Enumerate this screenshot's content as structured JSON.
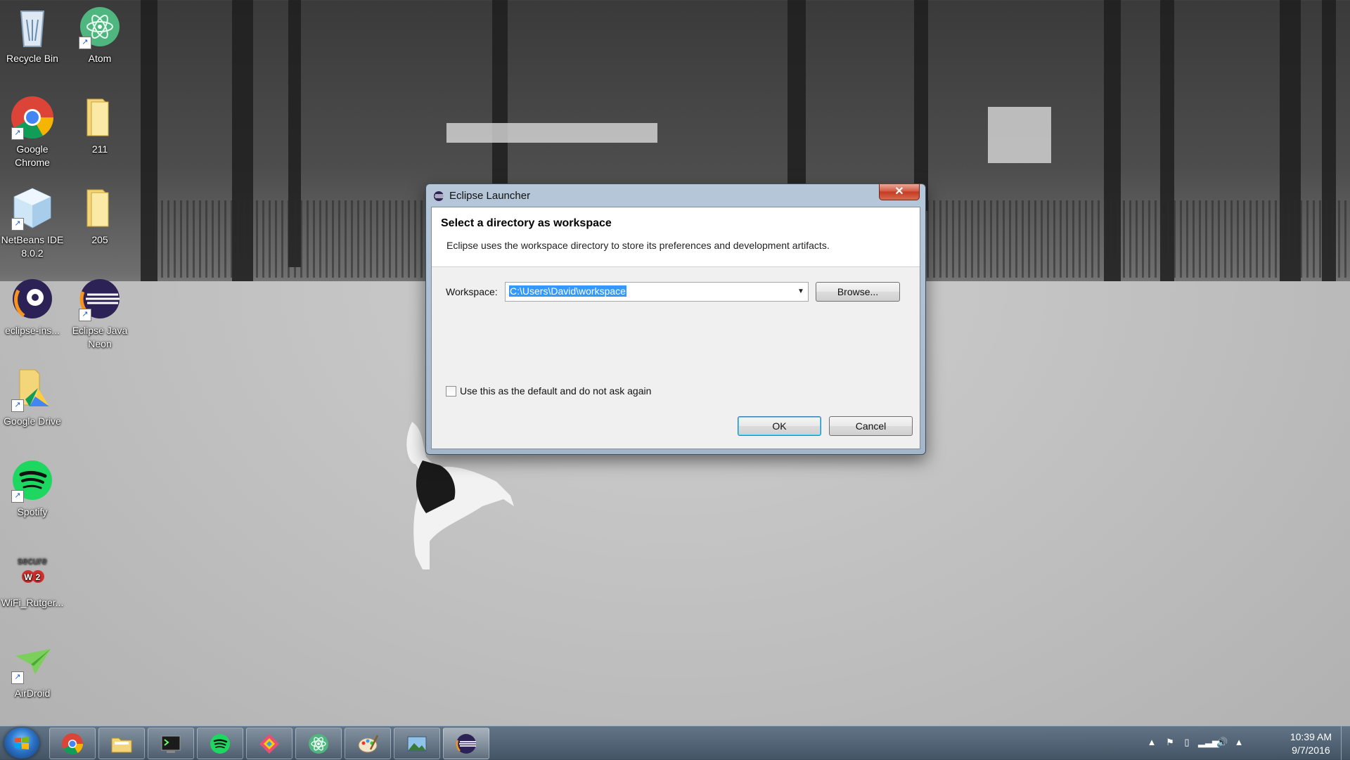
{
  "desktop": {
    "icons": [
      {
        "label": "Recycle Bin"
      },
      {
        "label": "Atom"
      },
      {
        "label": "Google Chrome"
      },
      {
        "label": "211"
      },
      {
        "label": "NetBeans IDE 8.0.2"
      },
      {
        "label": "205"
      },
      {
        "label": "eclipse-ins..."
      },
      {
        "label": "Eclipse Java Neon"
      },
      {
        "label": "Google Drive"
      },
      {
        "label": "Spotify"
      },
      {
        "label": "WiFi_Rutger..."
      },
      {
        "label": "AirDroid"
      }
    ],
    "secure_w2_logo_text": "secure W2"
  },
  "dialog": {
    "window_title": "Eclipse Launcher",
    "close_glyph": "✕",
    "header_title": "Select a directory as workspace",
    "header_description": "Eclipse uses the workspace directory to store its preferences and development artifacts.",
    "workspace_label": "Workspace:",
    "workspace_value": "C:\\Users\\David\\workspace",
    "browse_label": "Browse...",
    "default_checkbox_label": "Use this as the default and do not ask again",
    "default_checked": false,
    "ok_label": "OK",
    "cancel_label": "Cancel"
  },
  "taskbar": {
    "pinned": [
      {
        "icon": "chrome-icon"
      },
      {
        "icon": "file-explorer-icon"
      },
      {
        "icon": "terminal-icon"
      },
      {
        "icon": "spotify-icon"
      },
      {
        "icon": "app-icon"
      },
      {
        "icon": "atom-icon"
      },
      {
        "icon": "paint-icon"
      },
      {
        "icon": "photos-icon"
      },
      {
        "icon": "eclipse-icon",
        "active": true
      }
    ],
    "clock_time": "10:39 AM",
    "clock_date": "9/7/2016"
  },
  "colors": {
    "selection": "#3399ff",
    "dialog_frame": "#b6c7d9",
    "close_button": "#c33b22"
  }
}
